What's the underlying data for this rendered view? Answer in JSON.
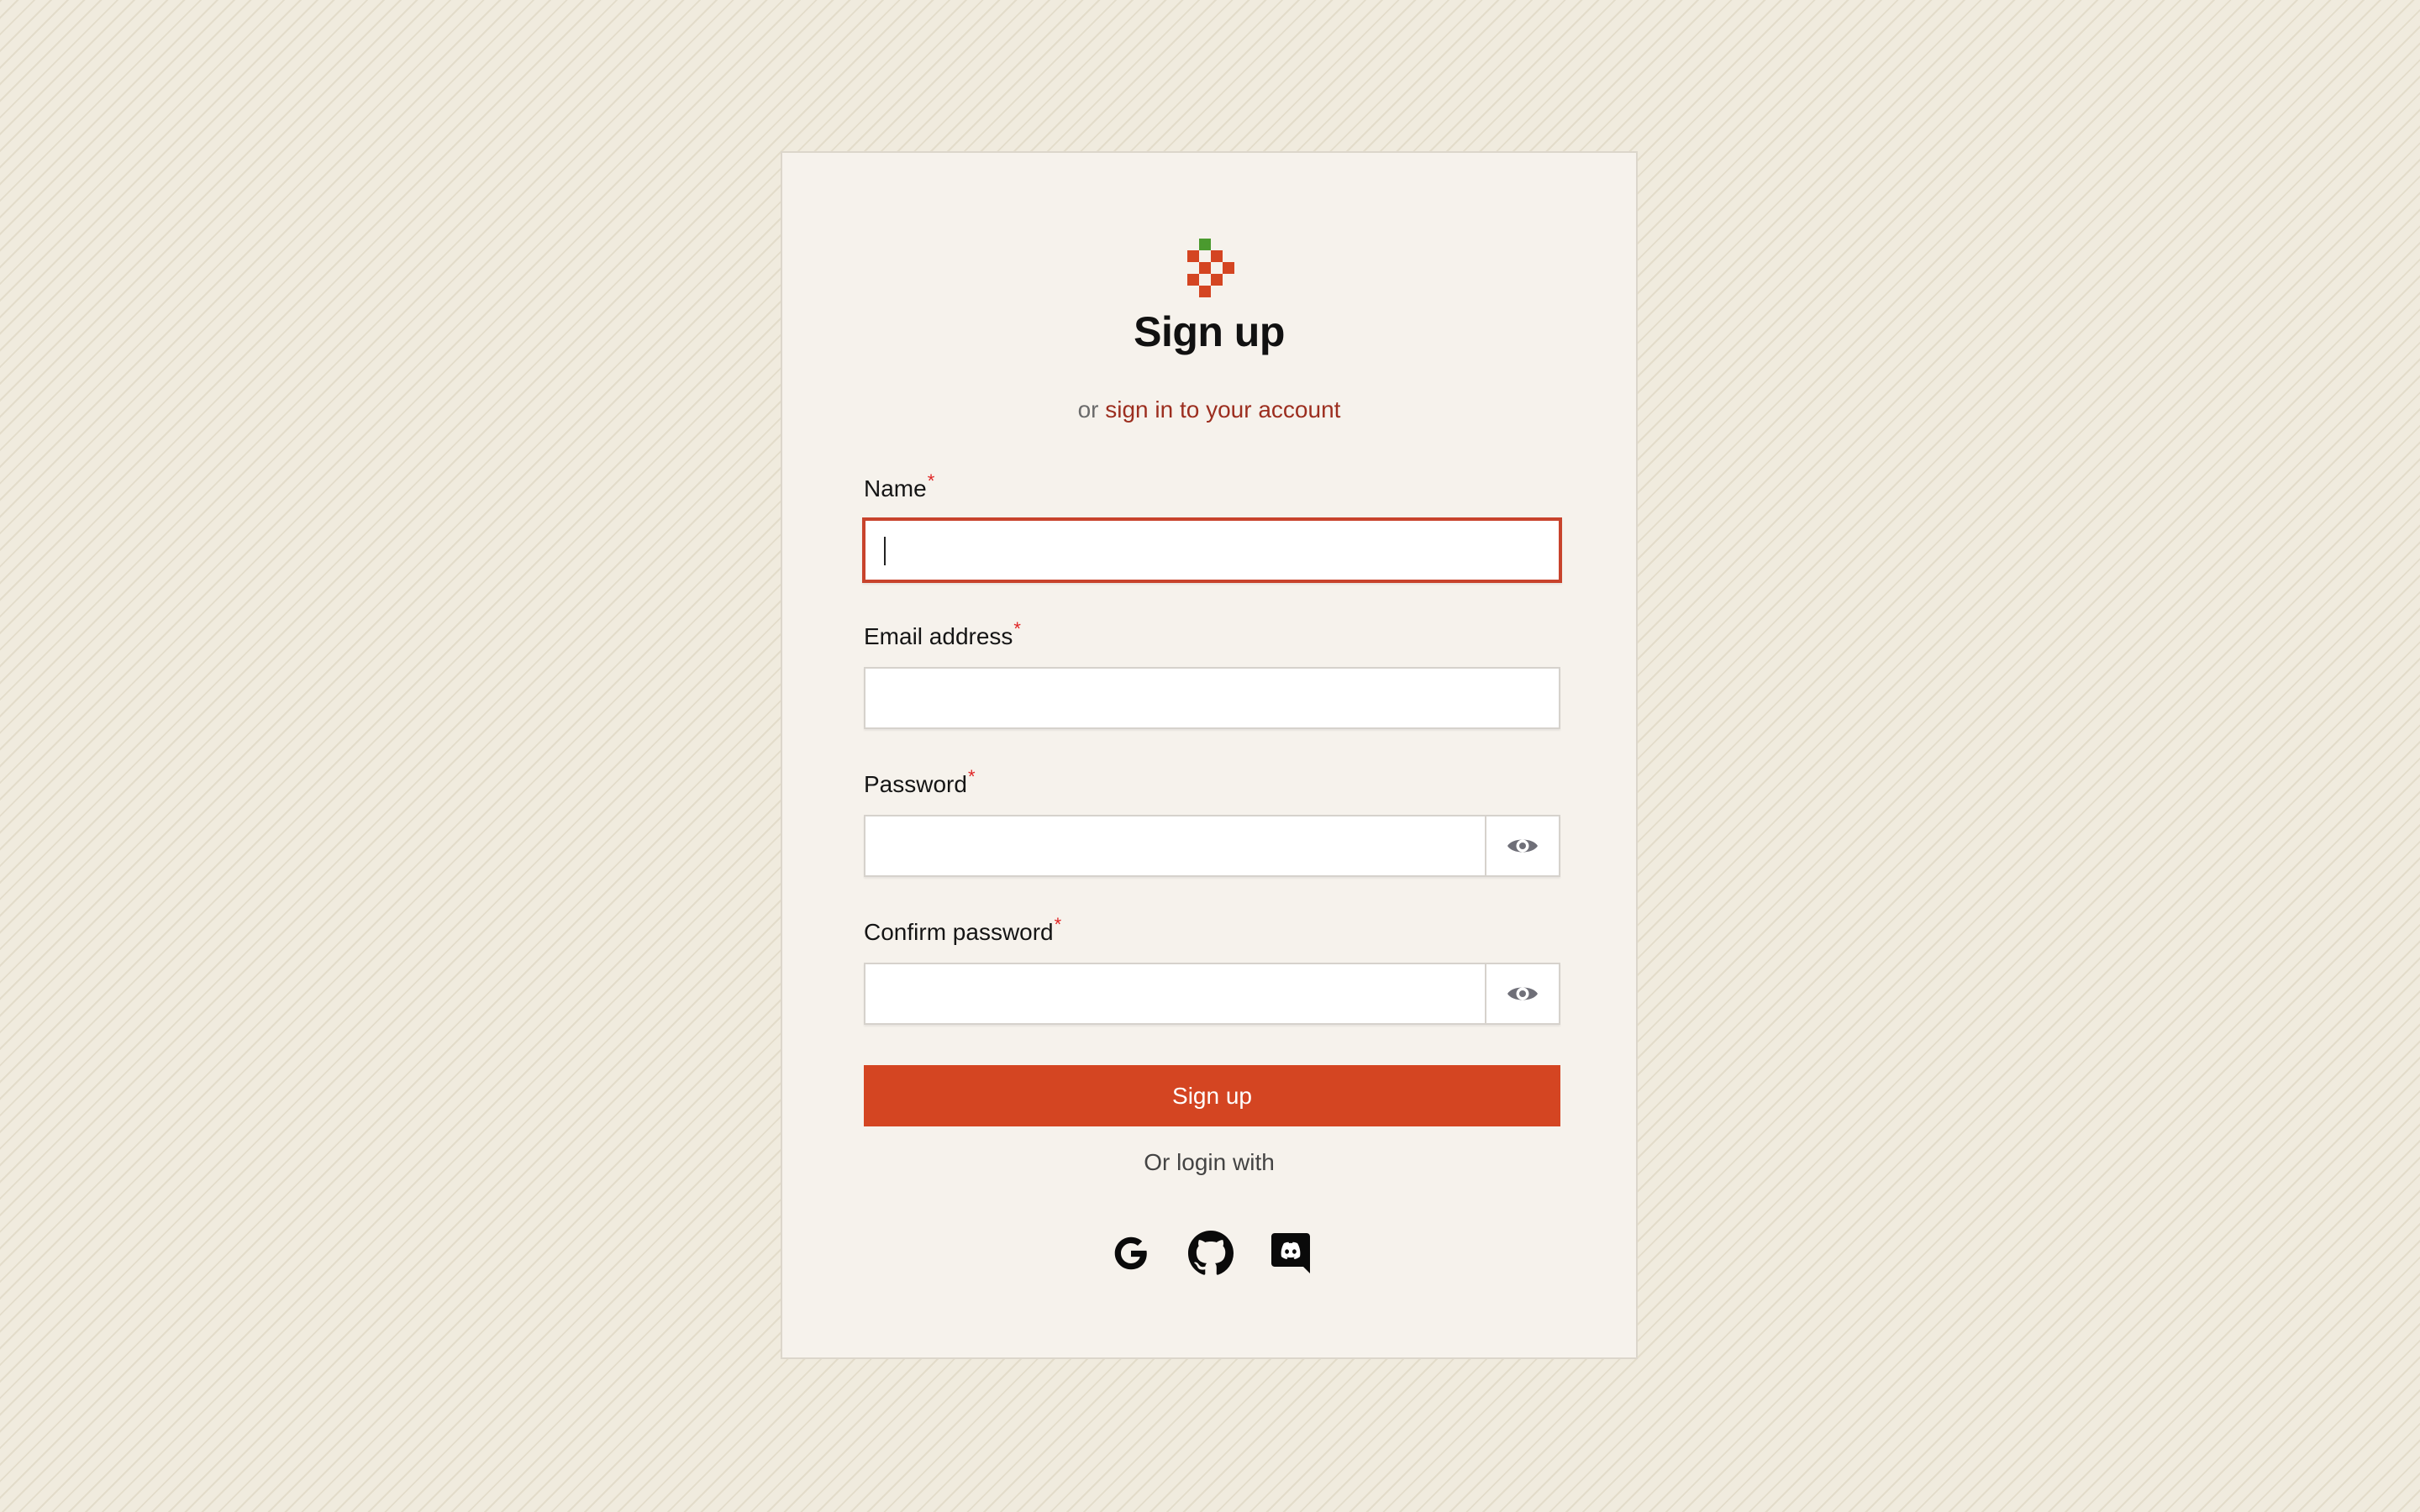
{
  "brand": {
    "logo_icon": "pixel-strawberry-icon",
    "accent_color": "#d44522",
    "link_color": "#9c2e1f"
  },
  "header": {
    "title": "Sign up",
    "subtitle_prefix": "or",
    "signin_link": "sign in to your account"
  },
  "form": {
    "required_marker": "*",
    "name": {
      "label": "Name",
      "value": ""
    },
    "email": {
      "label": "Email address",
      "value": ""
    },
    "password": {
      "label": "Password",
      "value": "",
      "toggle_icon": "eye-icon"
    },
    "confirm_password": {
      "label": "Confirm password",
      "value": "",
      "toggle_icon": "eye-icon"
    },
    "submit_label": "Sign up"
  },
  "social": {
    "heading": "Or login with",
    "providers": [
      {
        "icon": "google-icon"
      },
      {
        "icon": "github-icon"
      },
      {
        "icon": "discord-icon"
      }
    ]
  }
}
